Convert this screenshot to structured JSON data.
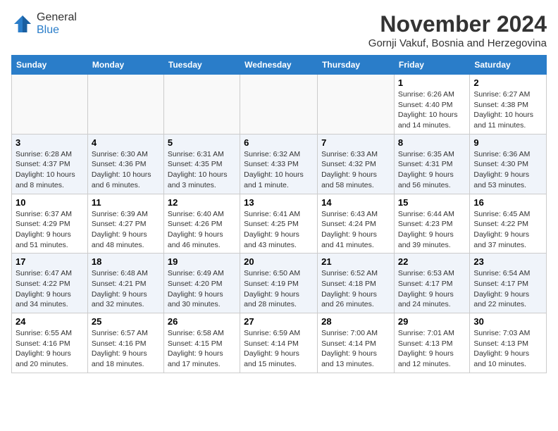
{
  "header": {
    "logo_general": "General",
    "logo_blue": "Blue",
    "month": "November 2024",
    "location": "Gornji Vakuf, Bosnia and Herzegovina"
  },
  "days_of_week": [
    "Sunday",
    "Monday",
    "Tuesday",
    "Wednesday",
    "Thursday",
    "Friday",
    "Saturday"
  ],
  "weeks": [
    {
      "shaded": false,
      "days": [
        {
          "num": "",
          "info": ""
        },
        {
          "num": "",
          "info": ""
        },
        {
          "num": "",
          "info": ""
        },
        {
          "num": "",
          "info": ""
        },
        {
          "num": "",
          "info": ""
        },
        {
          "num": "1",
          "info": "Sunrise: 6:26 AM\nSunset: 4:40 PM\nDaylight: 10 hours and 14 minutes."
        },
        {
          "num": "2",
          "info": "Sunrise: 6:27 AM\nSunset: 4:38 PM\nDaylight: 10 hours and 11 minutes."
        }
      ]
    },
    {
      "shaded": true,
      "days": [
        {
          "num": "3",
          "info": "Sunrise: 6:28 AM\nSunset: 4:37 PM\nDaylight: 10 hours and 8 minutes."
        },
        {
          "num": "4",
          "info": "Sunrise: 6:30 AM\nSunset: 4:36 PM\nDaylight: 10 hours and 6 minutes."
        },
        {
          "num": "5",
          "info": "Sunrise: 6:31 AM\nSunset: 4:35 PM\nDaylight: 10 hours and 3 minutes."
        },
        {
          "num": "6",
          "info": "Sunrise: 6:32 AM\nSunset: 4:33 PM\nDaylight: 10 hours and 1 minute."
        },
        {
          "num": "7",
          "info": "Sunrise: 6:33 AM\nSunset: 4:32 PM\nDaylight: 9 hours and 58 minutes."
        },
        {
          "num": "8",
          "info": "Sunrise: 6:35 AM\nSunset: 4:31 PM\nDaylight: 9 hours and 56 minutes."
        },
        {
          "num": "9",
          "info": "Sunrise: 6:36 AM\nSunset: 4:30 PM\nDaylight: 9 hours and 53 minutes."
        }
      ]
    },
    {
      "shaded": false,
      "days": [
        {
          "num": "10",
          "info": "Sunrise: 6:37 AM\nSunset: 4:29 PM\nDaylight: 9 hours and 51 minutes."
        },
        {
          "num": "11",
          "info": "Sunrise: 6:39 AM\nSunset: 4:27 PM\nDaylight: 9 hours and 48 minutes."
        },
        {
          "num": "12",
          "info": "Sunrise: 6:40 AM\nSunset: 4:26 PM\nDaylight: 9 hours and 46 minutes."
        },
        {
          "num": "13",
          "info": "Sunrise: 6:41 AM\nSunset: 4:25 PM\nDaylight: 9 hours and 43 minutes."
        },
        {
          "num": "14",
          "info": "Sunrise: 6:43 AM\nSunset: 4:24 PM\nDaylight: 9 hours and 41 minutes."
        },
        {
          "num": "15",
          "info": "Sunrise: 6:44 AM\nSunset: 4:23 PM\nDaylight: 9 hours and 39 minutes."
        },
        {
          "num": "16",
          "info": "Sunrise: 6:45 AM\nSunset: 4:22 PM\nDaylight: 9 hours and 37 minutes."
        }
      ]
    },
    {
      "shaded": true,
      "days": [
        {
          "num": "17",
          "info": "Sunrise: 6:47 AM\nSunset: 4:22 PM\nDaylight: 9 hours and 34 minutes."
        },
        {
          "num": "18",
          "info": "Sunrise: 6:48 AM\nSunset: 4:21 PM\nDaylight: 9 hours and 32 minutes."
        },
        {
          "num": "19",
          "info": "Sunrise: 6:49 AM\nSunset: 4:20 PM\nDaylight: 9 hours and 30 minutes."
        },
        {
          "num": "20",
          "info": "Sunrise: 6:50 AM\nSunset: 4:19 PM\nDaylight: 9 hours and 28 minutes."
        },
        {
          "num": "21",
          "info": "Sunrise: 6:52 AM\nSunset: 4:18 PM\nDaylight: 9 hours and 26 minutes."
        },
        {
          "num": "22",
          "info": "Sunrise: 6:53 AM\nSunset: 4:17 PM\nDaylight: 9 hours and 24 minutes."
        },
        {
          "num": "23",
          "info": "Sunrise: 6:54 AM\nSunset: 4:17 PM\nDaylight: 9 hours and 22 minutes."
        }
      ]
    },
    {
      "shaded": false,
      "days": [
        {
          "num": "24",
          "info": "Sunrise: 6:55 AM\nSunset: 4:16 PM\nDaylight: 9 hours and 20 minutes."
        },
        {
          "num": "25",
          "info": "Sunrise: 6:57 AM\nSunset: 4:16 PM\nDaylight: 9 hours and 18 minutes."
        },
        {
          "num": "26",
          "info": "Sunrise: 6:58 AM\nSunset: 4:15 PM\nDaylight: 9 hours and 17 minutes."
        },
        {
          "num": "27",
          "info": "Sunrise: 6:59 AM\nSunset: 4:14 PM\nDaylight: 9 hours and 15 minutes."
        },
        {
          "num": "28",
          "info": "Sunrise: 7:00 AM\nSunset: 4:14 PM\nDaylight: 9 hours and 13 minutes."
        },
        {
          "num": "29",
          "info": "Sunrise: 7:01 AM\nSunset: 4:13 PM\nDaylight: 9 hours and 12 minutes."
        },
        {
          "num": "30",
          "info": "Sunrise: 7:03 AM\nSunset: 4:13 PM\nDaylight: 9 hours and 10 minutes."
        }
      ]
    }
  ]
}
